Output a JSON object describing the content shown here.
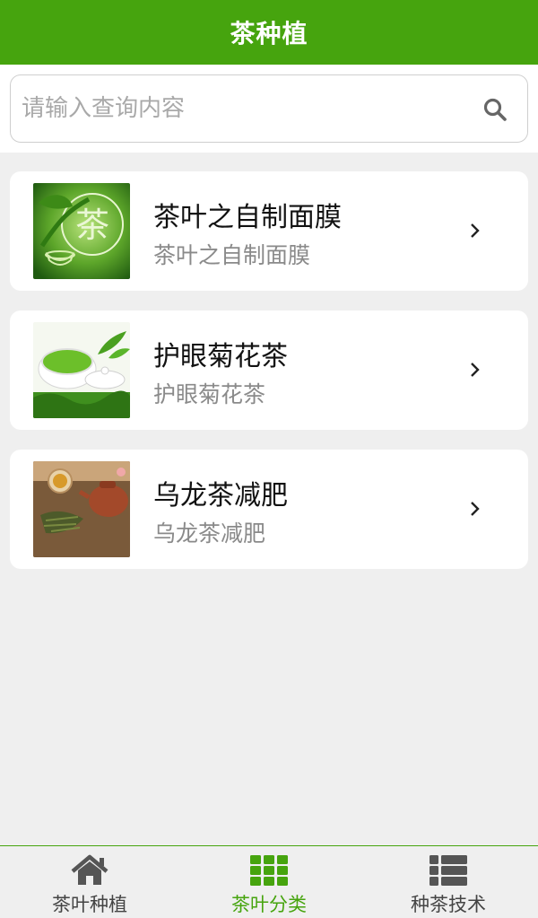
{
  "header": {
    "title": "茶种植"
  },
  "search": {
    "placeholder": "请输入查询内容",
    "value": ""
  },
  "items": [
    {
      "title": "茶叶之自制面膜",
      "subtitle": "茶叶之自制面膜",
      "thumb_label": "茶"
    },
    {
      "title": "护眼菊花茶",
      "subtitle": "护眼菊花茶",
      "thumb_label": ""
    },
    {
      "title": "乌龙茶减肥",
      "subtitle": "乌龙茶减肥",
      "thumb_label": ""
    }
  ],
  "tabs": [
    {
      "label": "茶叶种植",
      "icon": "home-icon",
      "active": false
    },
    {
      "label": "茶叶分类",
      "icon": "grid-icon",
      "active": true
    },
    {
      "label": "种茶技术",
      "icon": "list-icon",
      "active": false
    }
  ],
  "colors": {
    "brand": "#46a40e",
    "background": "#efefef"
  }
}
